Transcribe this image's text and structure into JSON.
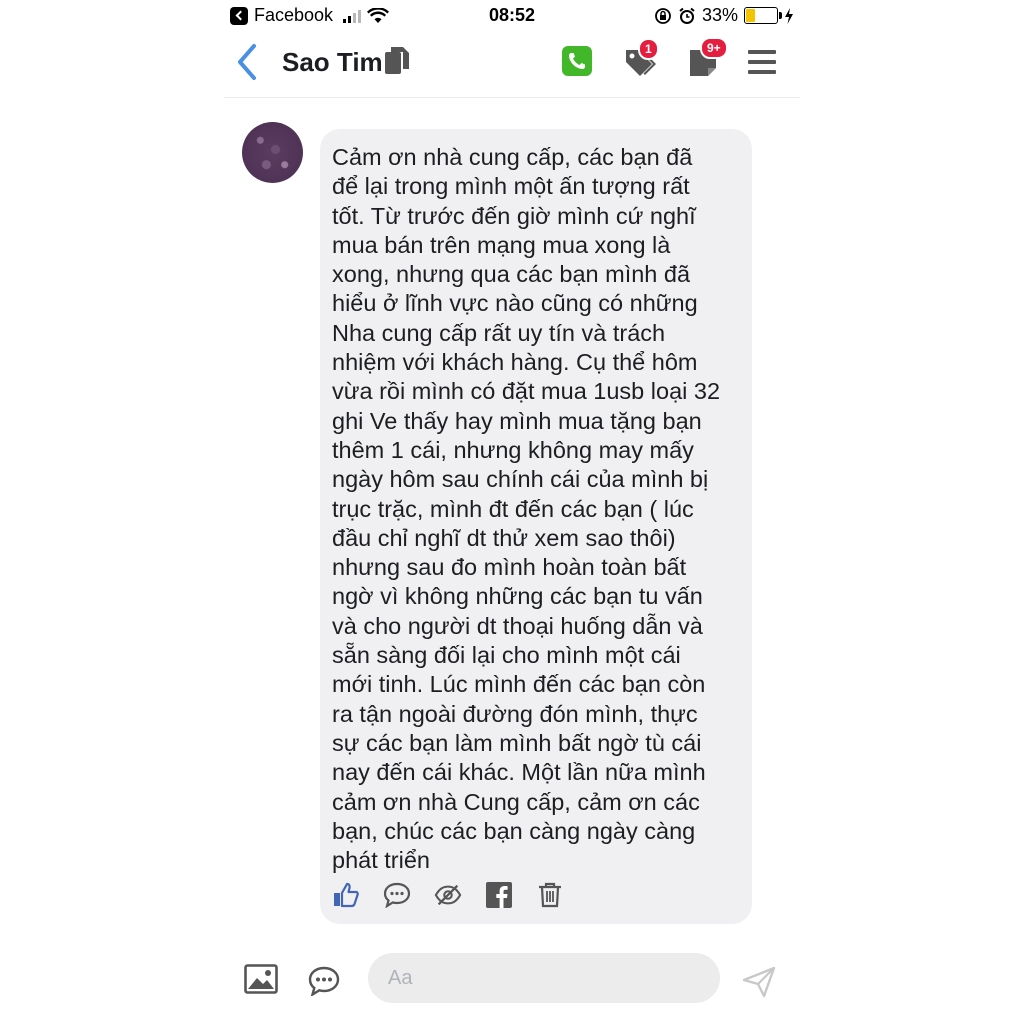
{
  "status_bar": {
    "back_app_label": "Facebook",
    "time": "08:52",
    "battery_percent": "33%",
    "battery_level": 0.33,
    "icons": [
      "signal-icon",
      "wifi-icon",
      "orientation-lock-icon",
      "alarm-icon",
      "battery-icon",
      "charging-bolt-icon"
    ]
  },
  "header": {
    "title": "Sao Tim",
    "notification_badge": "1",
    "message_badge": "9+",
    "accent_color": "#4a90e2",
    "call_color": "#42b72a",
    "icons": [
      "back-chevron-icon",
      "copy-icon",
      "phone-icon",
      "tags-icon",
      "notes-icon",
      "menu-icon"
    ]
  },
  "message": {
    "lines": [
      "Cảm ơn nhà cung cấp, các bạn đã",
      "để lại trong mình một ấn tượng rất",
      "tốt. Từ trước đến giờ mình cứ nghĩ",
      "mua bán trên mạng mua xong là",
      "xong, nhưng qua các bạn mình đã",
      "hiểu ở lĩnh vực nào cũng có những",
      "Nha cung cấp rất uy tín và trách",
      "nhiệm với khách hàng. Cụ thể hôm",
      "vừa rồi mình có đặt mua 1usb loại 32",
      "ghi Ve thấy hay mình mua tặng bạn",
      "thêm 1 cái, nhưng không may mấy",
      "ngày hôm sau chính cái của mình bị",
      "trục trặc, mình đt đến các bạn ( lúc",
      "đầu chỉ nghĩ dt thử xem sao thôi)",
      "nhưng sau đo mình hoàn toàn bất",
      "ngờ vì không những các bạn tu vấn",
      "và cho người dt thoại huống dẫn và",
      "sẵn sàng đối lại cho mình một cái",
      "mới tinh. Lúc mình đến các bạn còn",
      "ra tận ngoài đường đón mình, thực",
      "sự các bạn làm mình bất ngờ tù cái",
      "nay đến cái khác. Một lần nữa mình",
      "cảm ơn nhà Cung cấp, cảm ơn các",
      "bạn, chúc các bạn càng ngày càng",
      "phát triển"
    ],
    "bubble_color": "#f0f0f2",
    "action_icons": [
      "like-icon",
      "comment-icon",
      "hide-icon",
      "facebook-icon",
      "trash-icon"
    ]
  },
  "composer": {
    "placeholder": "Aa",
    "value": "",
    "icons": [
      "image-icon",
      "chat-bubble-icon",
      "send-icon"
    ]
  }
}
